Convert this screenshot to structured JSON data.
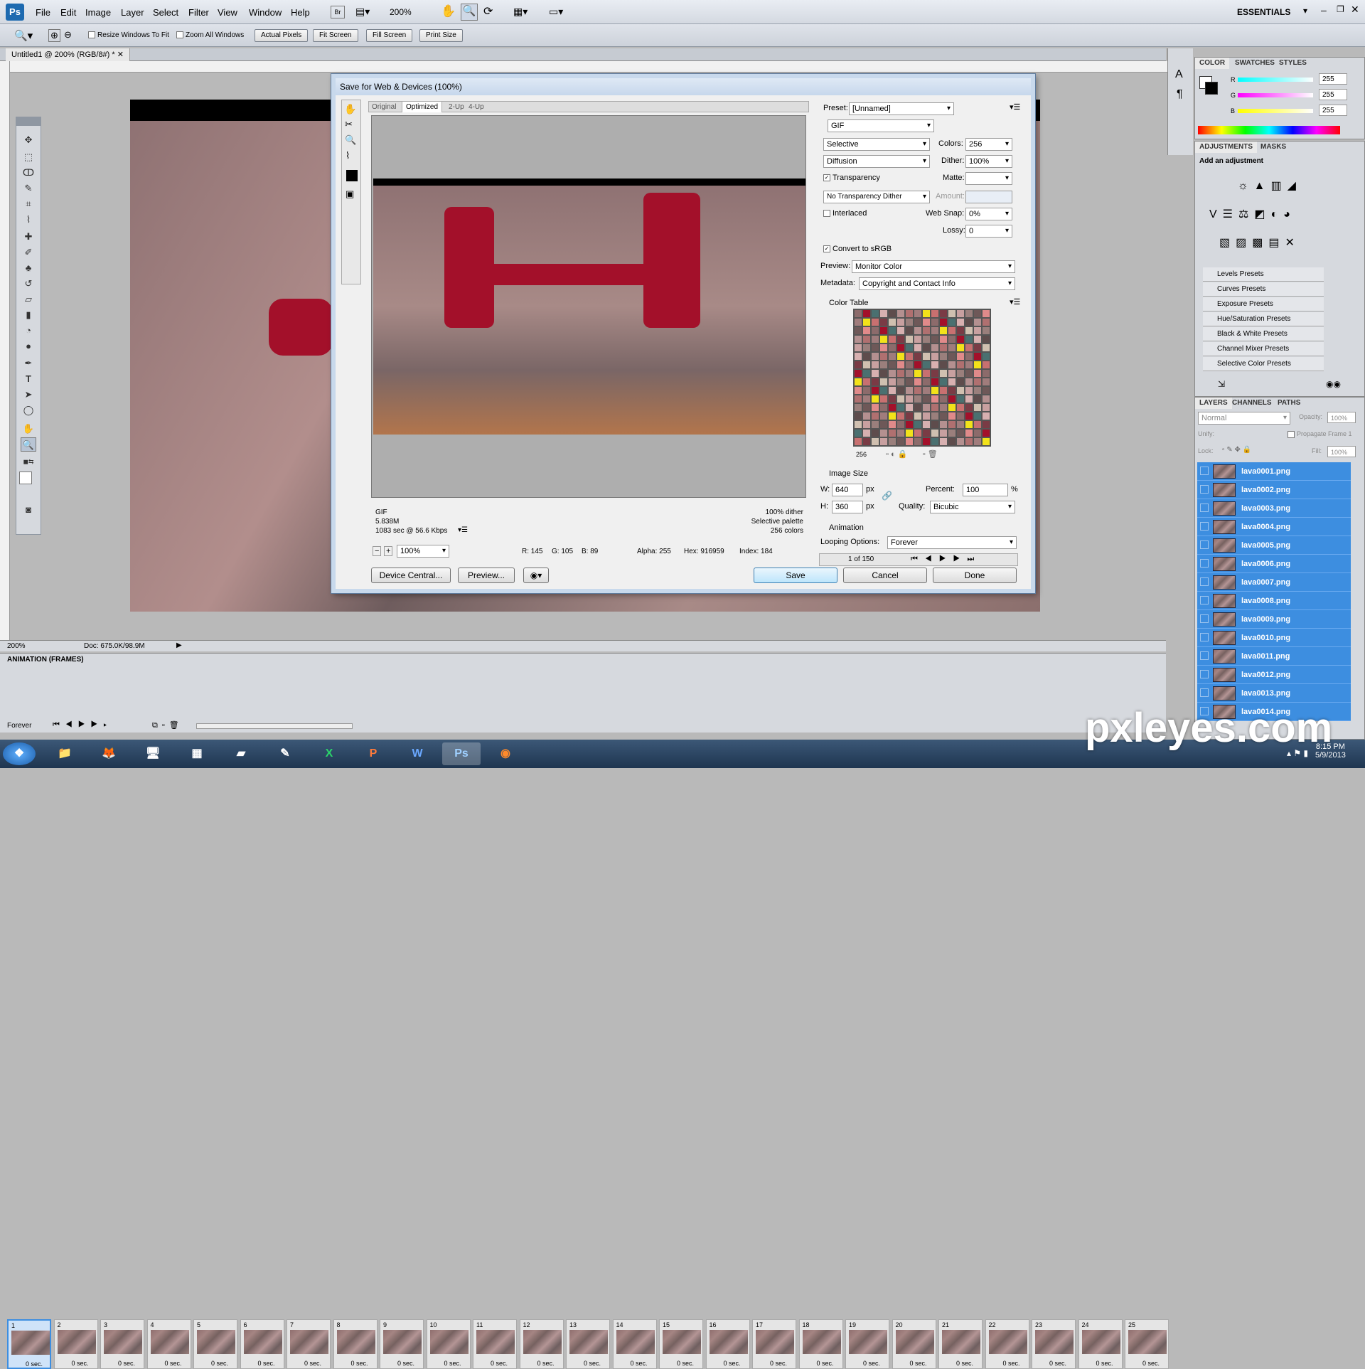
{
  "app": {
    "logo": "Ps",
    "workspace": "ESSENTIALS",
    "zoom_menu": "200%"
  },
  "menus": [
    "File",
    "Edit",
    "Image",
    "Layer",
    "Select",
    "Filter",
    "View",
    "Window",
    "Help"
  ],
  "options": {
    "resize_windows": "Resize Windows To Fit",
    "zoom_all": "Zoom All Windows",
    "actual_pixels": "Actual Pixels",
    "fit_screen": "Fit Screen",
    "fill_screen": "Fill Screen",
    "print_size": "Print Size"
  },
  "doc_tab": "Untitled1 @ 200% (RGB/8#) *",
  "status": {
    "zoom": "200%",
    "doc": "Doc: 675.0K/98.9M"
  },
  "dialog": {
    "title": "Save for Web & Devices (100%)",
    "tabs": [
      "Original",
      "Optimized",
      "2-Up",
      "4-Up"
    ],
    "preset_label": "Preset:",
    "preset_value": "[Unnamed]",
    "format": "GIF",
    "reduction": "Selective",
    "colors_label": "Colors:",
    "colors_value": "256",
    "dither_algo": "Diffusion",
    "dither_label": "Dither:",
    "dither_value": "100%",
    "transparency": "Transparency",
    "matte_label": "Matte:",
    "trans_dither": "No Transparency Dither",
    "amount_label": "Amount:",
    "interlaced": "Interlaced",
    "websnap_label": "Web Snap:",
    "websnap_value": "0%",
    "lossy_label": "Lossy:",
    "lossy_value": "0",
    "convert_srgb": "Convert to sRGB",
    "preview_label": "Preview:",
    "preview_value": "Monitor Color",
    "metadata_label": "Metadata:",
    "metadata_value": "Copyright and Contact Info",
    "color_table_label": "Color Table",
    "color_count": "256",
    "image_size_label": "Image Size",
    "w_label": "W:",
    "w_value": "640",
    "h_label": "H:",
    "h_value": "360",
    "px": "px",
    "percent_label": "Percent:",
    "percent_value": "100",
    "percent_sign": "%",
    "quality_label": "Quality:",
    "quality_value": "Bicubic",
    "animation_label": "Animation",
    "looping_label": "Looping Options:",
    "looping_value": "Forever",
    "frame_counter": "1 of 150",
    "info_left": [
      "GIF",
      "5.838M",
      "1083 sec @ 56.6 Kbps"
    ],
    "info_right": [
      "100% dither",
      "Selective palette",
      "256 colors"
    ],
    "zoom_value": "100%",
    "readout": {
      "r": "R: 145",
      "g": "G: 105",
      "b": "B: 89",
      "alpha": "Alpha: 255",
      "hex": "Hex: 916959",
      "index": "Index: 184"
    },
    "device_central": "Device Central...",
    "preview_btn": "Preview...",
    "save": "Save",
    "cancel": "Cancel",
    "done": "Done"
  },
  "color_panel": {
    "tabs": [
      "COLOR",
      "SWATCHES",
      "STYLES"
    ],
    "r": "255",
    "g": "255",
    "b": "255"
  },
  "adjust_panel": {
    "tabs": [
      "ADJUSTMENTS",
      "MASKS"
    ],
    "heading": "Add an adjustment",
    "presets": [
      "Levels Presets",
      "Curves Presets",
      "Exposure Presets",
      "Hue/Saturation Presets",
      "Black & White Presets",
      "Channel Mixer Presets",
      "Selective Color Presets"
    ]
  },
  "layers_panel": {
    "tabs": [
      "LAYERS",
      "CHANNELS",
      "PATHS"
    ],
    "blend": "Normal",
    "opacity_label": "Opacity:",
    "opacity": "100%",
    "unify": "Unify:",
    "propagate": "Propagate Frame 1",
    "lock": "Lock:",
    "fill_label": "Fill:",
    "fill": "100%",
    "layers": [
      "lava0001.png",
      "lava0002.png",
      "lava0003.png",
      "lava0004.png",
      "lava0005.png",
      "lava0006.png",
      "lava0007.png",
      "lava0008.png",
      "lava0009.png",
      "lava0010.png",
      "lava0011.png",
      "lava0012.png",
      "lava0013.png",
      "lava0014.png"
    ]
  },
  "animation": {
    "title": "ANIMATION (FRAMES)",
    "loop": "Forever",
    "delay": "0 sec.",
    "frames": [
      "1",
      "2",
      "3",
      "4",
      "5",
      "6",
      "7",
      "8",
      "9",
      "10",
      "11",
      "12",
      "13",
      "14",
      "15",
      "16",
      "17",
      "18",
      "19",
      "20",
      "21",
      "22",
      "23",
      "24",
      "25"
    ]
  },
  "clock": {
    "time": "8:15 PM",
    "date": "5/9/2013"
  },
  "watermark": "pxleyes.com",
  "colors": {
    "accent": "#3d8ee0",
    "lava_red": "#a3102a",
    "lava_yellow": "#f2e21a"
  }
}
